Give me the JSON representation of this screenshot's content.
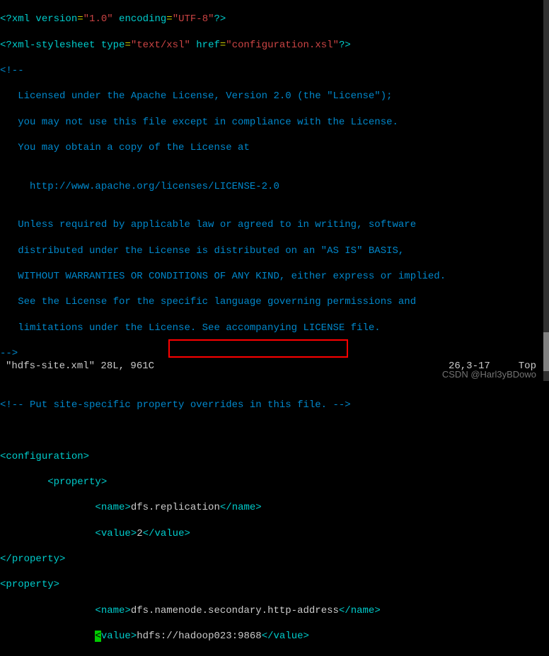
{
  "xml": {
    "decl_open": "<?",
    "decl_xml": "xml version",
    "decl_eq1": "=",
    "decl_ver": "\"1.0\"",
    "decl_enc_kw": " encoding",
    "decl_eq2": "=",
    "decl_enc": "\"UTF-8\"",
    "decl_close": "?>",
    "ss_open": "<?",
    "ss_kw": "xml-stylesheet type",
    "ss_eq1": "=",
    "ss_type": "\"text/xsl\"",
    "ss_href_kw": " href",
    "ss_eq2": "=",
    "ss_href": "\"configuration.xsl\"",
    "ss_close": "?>"
  },
  "comment": {
    "open": "<!--",
    "l1": "   Licensed under the Apache License, Version 2.0 (the \"License\");",
    "l2": "   you may not use this file except in compliance with the License.",
    "l3": "   You may obtain a copy of the License at",
    "l4": "",
    "l5": "     http://www.apache.org/licenses/LICENSE-2.0",
    "l6": "",
    "l7": "   Unless required by applicable law or agreed to in writing, software",
    "l8": "   distributed under the License is distributed on an \"AS IS\" BASIS,",
    "l9": "   WITHOUT WARRANTIES OR CONDITIONS OF ANY KIND, either express or implied.",
    "l10": "   See the License for the specific language governing permissions and",
    "l11": "   limitations under the License. See accompanying LICENSE file.",
    "close": "-->",
    "site": "<!-- Put site-specific property overrides in this file. -->"
  },
  "conf": {
    "open": "<",
    "conf_tag": "configuration",
    "close": ">",
    "indent2": "        ",
    "indent4": "                ",
    "prop_tag": "property",
    "end_open": "</",
    "name_tag": "name",
    "value_tag": "value",
    "name1": "dfs.replication",
    "val1": "2",
    "name2": "dfs.namenode.secondary.http-address",
    "val2_pre": "hdf",
    "val2_cursor": "s",
    "val2_post": "://hadoop023:9868"
  },
  "status": {
    "file": "\"hdfs-site.xml\" 28L, 961C",
    "pos": "26,3-17",
    "loc": "Top"
  },
  "watermark": "CSDN @Harl3yBDowo"
}
